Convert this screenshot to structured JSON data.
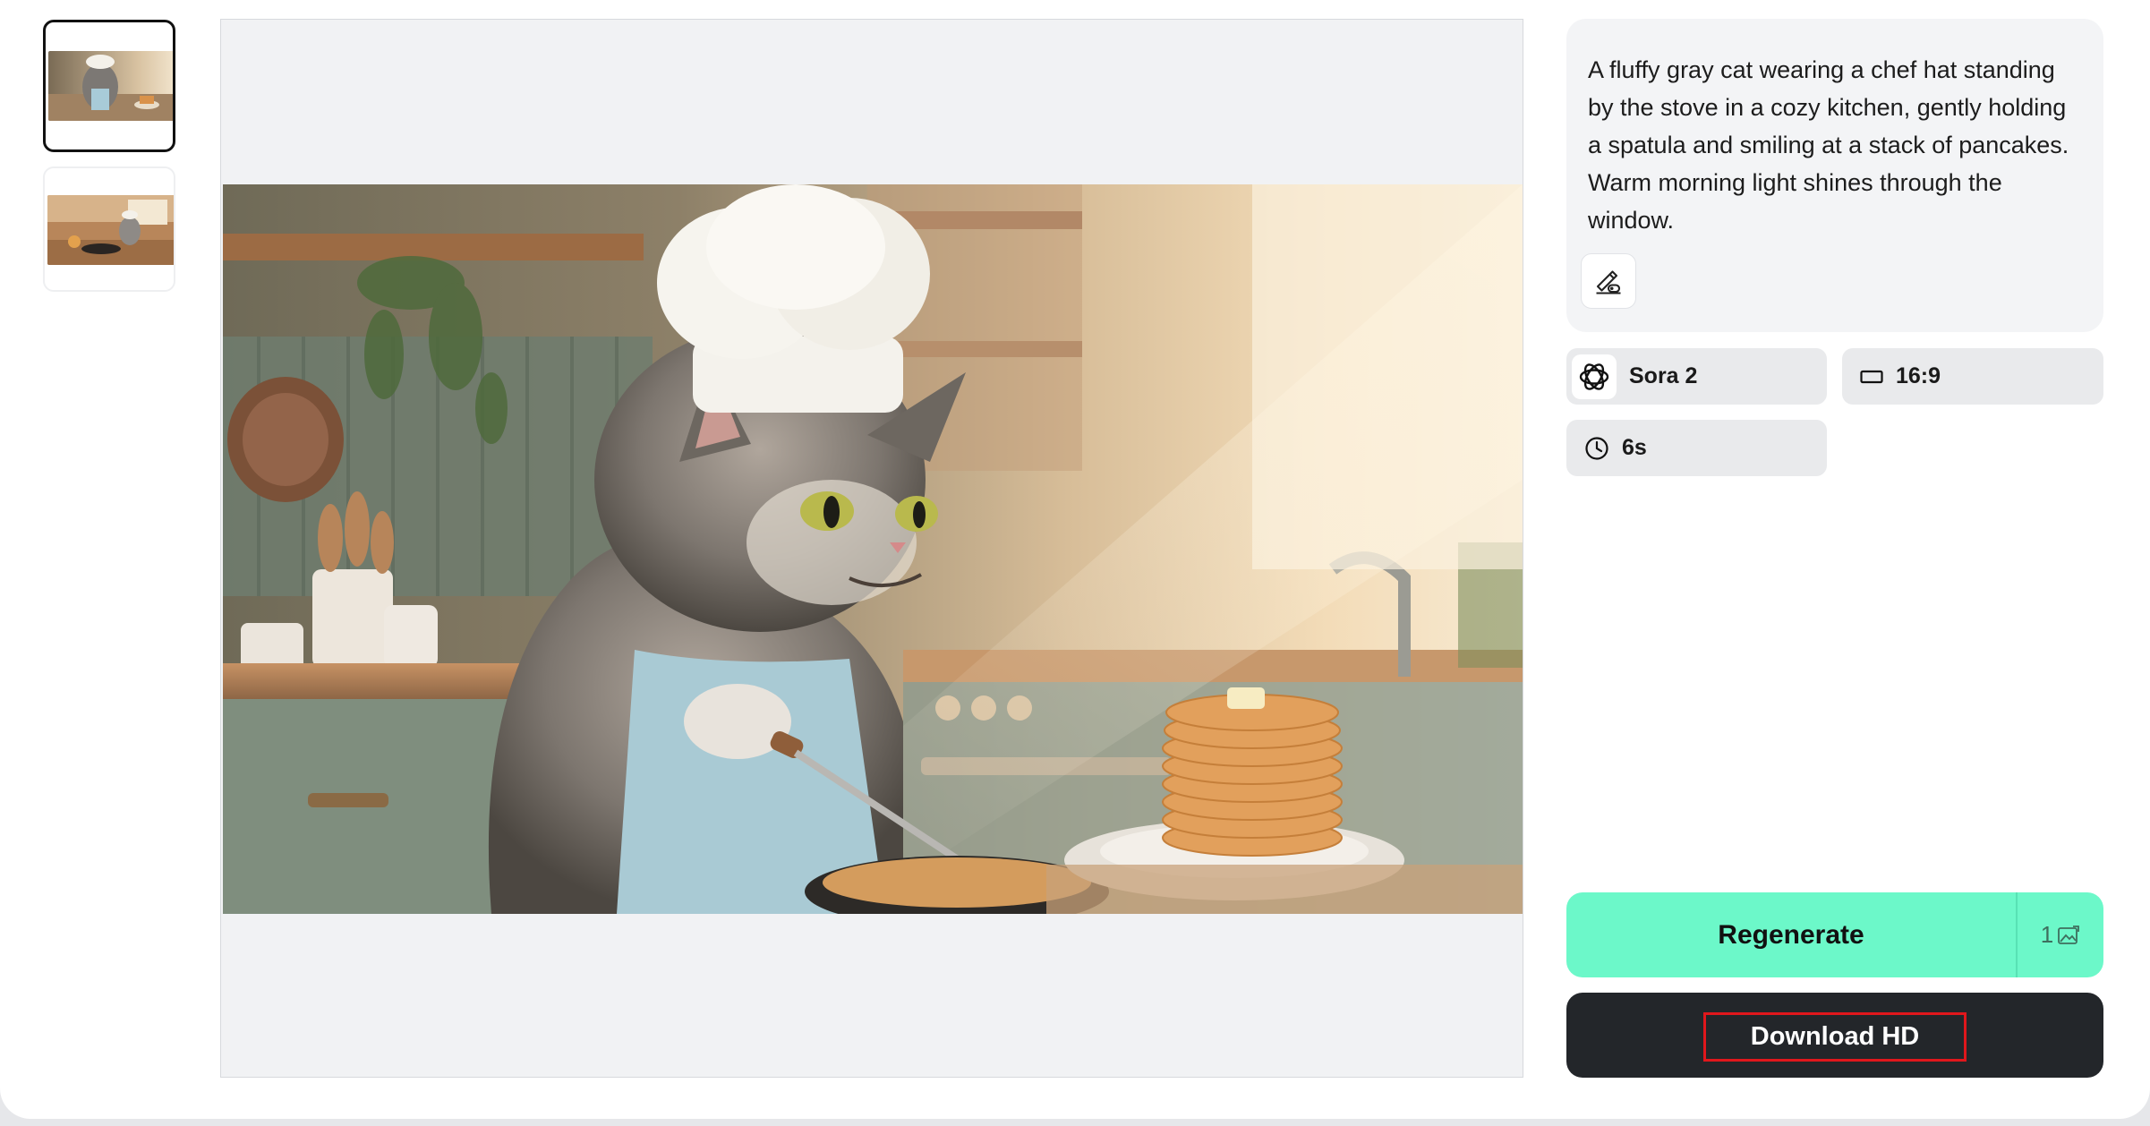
{
  "prompt": {
    "text": "A fluffy gray cat wearing a chef hat standing by the stove in a cozy kitchen, gently holding a spatula and smiling at a stack of pancakes. Warm morning light shines through the window.",
    "edit_icon": "edit-pen-icon"
  },
  "settings": {
    "model": "Sora 2",
    "model_icon": "openai-logo-icon",
    "aspect_ratio": "16:9",
    "aspect_icon": "rectangle-icon",
    "duration": "6s",
    "duration_icon": "clock-icon"
  },
  "actions": {
    "regenerate_label": "Regenerate",
    "regenerate_credit": "1",
    "credit_icon": "image-credit-icon",
    "download_label": "Download HD"
  },
  "thumbnails": [
    {
      "selected": true
    },
    {
      "selected": false
    }
  ],
  "colors": {
    "regenerate_bg": "#6cf8c9",
    "download_bg": "#23262a",
    "highlight": "#e0171c"
  }
}
